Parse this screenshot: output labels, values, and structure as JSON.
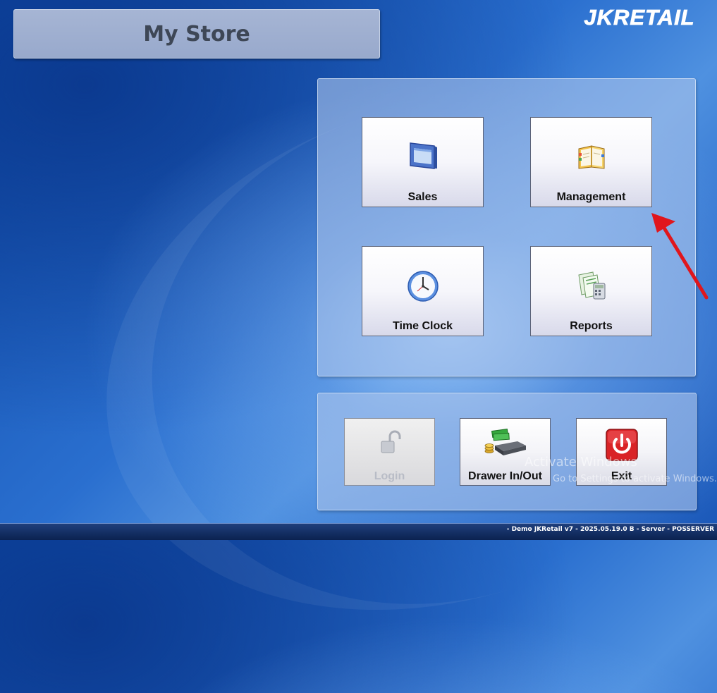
{
  "header": {
    "store_name": "My Store",
    "brand_logo_text": "JKRETAIL"
  },
  "main_menu": {
    "tiles": [
      {
        "label": "Sales",
        "icon": "monitor-window-icon"
      },
      {
        "label": "Management",
        "icon": "day-planner-book-icon"
      },
      {
        "label": "Time Clock",
        "icon": "clock-icon"
      },
      {
        "label": "Reports",
        "icon": "reports-calculator-icon"
      }
    ]
  },
  "actions": {
    "tiles": [
      {
        "label": "Login",
        "icon": "padlock-open-icon",
        "state": "disabled"
      },
      {
        "label": "Drawer In/Out",
        "icon": "cash-drawer-icon",
        "state": "enabled"
      },
      {
        "label": "Exit",
        "icon": "power-icon",
        "state": "enabled"
      }
    ]
  },
  "watermark": {
    "title": "Activate Windows",
    "subtitle": "Go to Settings to activate Windows."
  },
  "status_bar": {
    "text": "- Demo JKRetail v7 - 2025.05.19.0 B - Server - POSSERVER"
  },
  "colors": {
    "annotation_arrow": "#e0161c",
    "exit_icon_red": "#d92326"
  }
}
